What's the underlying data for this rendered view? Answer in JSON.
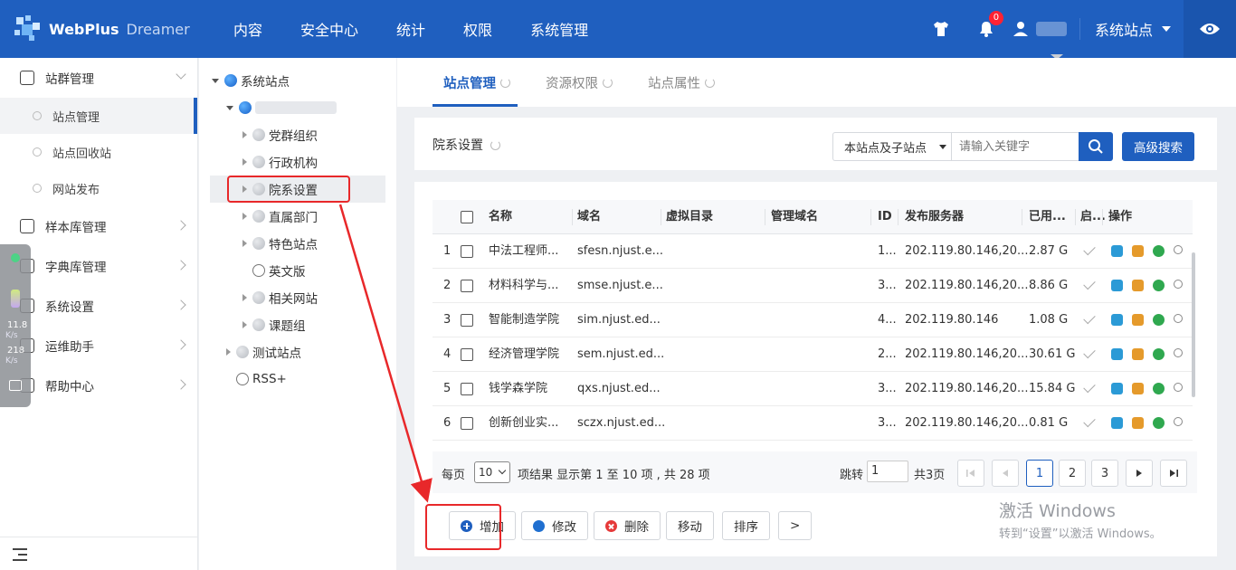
{
  "header": {
    "brand": "WebPlus",
    "brand_sub": "Dreamer",
    "nav": [
      "内容",
      "安全中心",
      "统计",
      "权限",
      "系统管理"
    ],
    "notification_count": "0",
    "site_select": "系统站点",
    "accent_color": "#1f5fbf"
  },
  "sidebar": {
    "groups": [
      {
        "label": "站群管理",
        "icon": "sites-icon"
      },
      {
        "label": "样本库管理",
        "icon": "sample-icon"
      },
      {
        "label": "字典库管理",
        "icon": "dict-icon"
      },
      {
        "label": "系统设置",
        "icon": "settings-icon"
      },
      {
        "label": "运维助手",
        "icon": "ops-icon"
      },
      {
        "label": "帮助中心",
        "icon": "help-icon"
      }
    ],
    "sub_items": [
      "站点管理",
      "站点回收站",
      "网站发布"
    ]
  },
  "speed_widget": {
    "up": "11.8",
    "down": "218",
    "unit": "K/s"
  },
  "tree": {
    "root": "系统站点",
    "children": [
      "党群组织",
      "行政机构",
      "院系设置",
      "直属部门",
      "特色站点",
      "英文版",
      "相关网站",
      "课题组"
    ],
    "test": "测试站点",
    "rss": "RSS+"
  },
  "tabs": [
    "站点管理",
    "资源权限",
    "站点属性"
  ],
  "toolbar": {
    "title": "院系设置",
    "scope": "本站点及子站点",
    "search_placeholder": "请输入关键字",
    "advanced": "高级搜索"
  },
  "table": {
    "columns": [
      "名称",
      "域名",
      "虚拟目录",
      "管理域名",
      "ID",
      "发布服务器",
      "已用...",
      "启...",
      "操作"
    ],
    "rows": [
      {
        "no": "1",
        "name": "中法工程师...",
        "domain": "sfesn.njust.e...",
        "id": "1...",
        "server": "202.119.80.146,20...",
        "used": "2.87 G"
      },
      {
        "no": "2",
        "name": "材料科学与...",
        "domain": "smse.njust.e...",
        "id": "3...",
        "server": "202.119.80.146,20...",
        "used": "8.86 G"
      },
      {
        "no": "3",
        "name": "智能制造学院",
        "domain": "sim.njust.ed...",
        "id": "4...",
        "server": "202.119.80.146",
        "used": "1.08 G"
      },
      {
        "no": "4",
        "name": "经济管理学院",
        "domain": "sem.njust.ed...",
        "id": "2...",
        "server": "202.119.80.146,20...",
        "used": "30.61 G"
      },
      {
        "no": "5",
        "name": "钱学森学院",
        "domain": "qxs.njust.ed...",
        "id": "3...",
        "server": "202.119.80.146,20...",
        "used": "15.84 G"
      },
      {
        "no": "6",
        "name": "创新创业实...",
        "domain": "sczx.njust.ed...",
        "id": "3...",
        "server": "202.119.80.146,20...",
        "used": "0.81 G"
      }
    ]
  },
  "pager": {
    "per_page": "每页",
    "size": "10",
    "info": "项结果 显示第 1 至 10 项 , 共 28 项",
    "jump": "跳转",
    "jump_value": "1",
    "total_pages": "共3页",
    "pages": [
      "1",
      "2",
      "3"
    ],
    "current": "1"
  },
  "actions": [
    "增加",
    "修改",
    "删除",
    "移动",
    "排序",
    ">"
  ],
  "watermark": {
    "line1": "激活 Windows",
    "line2": "转到“设置”以激活 Windows。"
  }
}
